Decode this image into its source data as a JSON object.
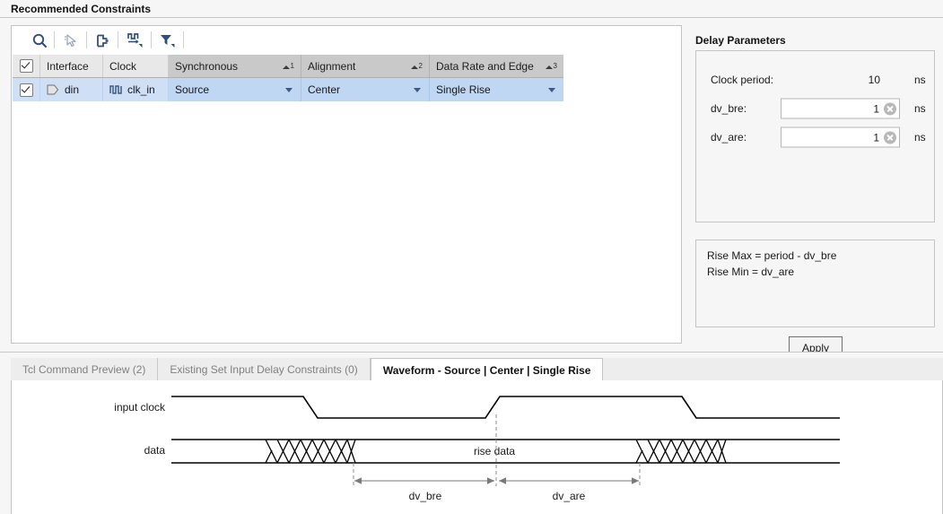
{
  "header": {
    "title": "Recommended Constraints"
  },
  "toolbar": {
    "buttons": [
      {
        "name": "search-icon",
        "tooltip": "Search"
      },
      {
        "name": "select-cursor-icon",
        "tooltip": "Select"
      },
      {
        "name": "auto-fit-icon",
        "tooltip": "Auto Fit"
      },
      {
        "name": "waveform-icon",
        "tooltip": "Waveform"
      },
      {
        "name": "filter-icon",
        "tooltip": "Filter"
      }
    ]
  },
  "table": {
    "columns": [
      {
        "label": "",
        "key": "check",
        "sort": null
      },
      {
        "label": "Interface",
        "key": "interface",
        "sort": null
      },
      {
        "label": "Clock",
        "key": "clock",
        "sort": null
      },
      {
        "label": "Synchronous",
        "key": "synchronous",
        "sort": "1"
      },
      {
        "label": "Alignment",
        "key": "alignment",
        "sort": "2"
      },
      {
        "label": "Data Rate and Edge",
        "key": "rate",
        "sort": "3"
      }
    ],
    "rows": [
      {
        "checked": true,
        "interface": "din",
        "clock": "clk_in",
        "synchronous": "Source",
        "alignment": "Center",
        "rate": "Single Rise"
      }
    ],
    "header_checkbox_checked": true
  },
  "delay": {
    "title": "Delay Parameters",
    "params": [
      {
        "label": "Clock period:",
        "value": "10",
        "unit": "ns",
        "editable": false
      },
      {
        "label": "dv_bre:",
        "value": "1",
        "unit": "ns",
        "editable": true
      },
      {
        "label": "dv_are:",
        "value": "1",
        "unit": "ns",
        "editable": true
      }
    ]
  },
  "equations": {
    "lines": [
      "Rise Max = period - dv_bre",
      "Rise Min = dv_are"
    ]
  },
  "apply": {
    "mnemonic": "A",
    "rest": "pply"
  },
  "tabs": [
    {
      "label": "Tcl Command Preview (2)",
      "active": false
    },
    {
      "label": "Existing Set Input Delay Constraints (0)",
      "active": false
    },
    {
      "label": "Waveform - Source | Center | Single Rise",
      "active": true
    }
  ],
  "waveform": {
    "signals": [
      {
        "label": "input clock"
      },
      {
        "label": "data"
      }
    ],
    "annotations": [
      {
        "label": "rise data"
      },
      {
        "label": "dv_bre"
      },
      {
        "label": "dv_are"
      }
    ]
  },
  "colors": {
    "selection_blue": "#bfd7f2",
    "header_gray": "#c9c9c9",
    "icon_blue": "#3d5a80",
    "panel_bg": "#f6f6f6"
  }
}
